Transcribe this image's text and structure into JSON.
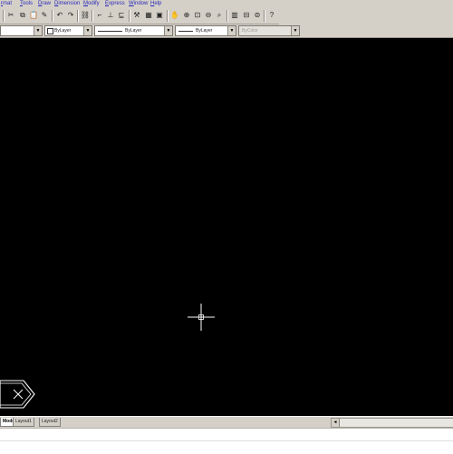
{
  "menubar": {
    "items": [
      "Format",
      "Tools",
      "Draw",
      "Dimension",
      "Modify",
      "Express",
      "Window",
      "Help"
    ],
    "visible_labels": [
      "rmat",
      "Tools",
      "Draw",
      "Dimension",
      "Modify",
      "Express",
      "Window",
      "Help"
    ]
  },
  "toolbar": {
    "buttons": [
      {
        "name": "cut-icon",
        "glyph": "✂"
      },
      {
        "name": "copy-icon",
        "glyph": "⧉"
      },
      {
        "name": "paste-icon",
        "glyph": "📋"
      },
      {
        "name": "match-properties-icon",
        "glyph": "✎"
      },
      {
        "name": "undo-icon",
        "glyph": "↶"
      },
      {
        "name": "redo-icon",
        "glyph": "↷"
      },
      {
        "name": "hyperlink-icon",
        "glyph": "⛓"
      },
      {
        "name": "osnap-icon",
        "glyph": "⌐"
      },
      {
        "name": "ucs-icon",
        "glyph": "⊥"
      },
      {
        "name": "redraw-icon",
        "glyph": "⊑"
      },
      {
        "name": "properties-icon",
        "glyph": "⚒"
      },
      {
        "name": "design-center-icon",
        "glyph": "▦"
      },
      {
        "name": "tool-palettes-icon",
        "glyph": "▣"
      },
      {
        "name": "pan-icon",
        "glyph": "✋"
      },
      {
        "name": "zoom-realtime-icon",
        "glyph": "⊕"
      },
      {
        "name": "zoom-window-icon",
        "glyph": "⊡"
      },
      {
        "name": "zoom-previous-icon",
        "glyph": "⊖"
      },
      {
        "name": "zoom-extents-icon",
        "glyph": "⌕"
      },
      {
        "name": "named-views-icon",
        "glyph": "▥"
      },
      {
        "name": "aerial-view-icon",
        "glyph": "⊟"
      },
      {
        "name": "distance-icon",
        "glyph": "⊜"
      },
      {
        "name": "help-icon",
        "glyph": "?"
      }
    ]
  },
  "properties": {
    "layer_value": "",
    "color_value": "ByLayer",
    "linetype_value": "ByLayer",
    "lineweight_value": "ByLayer",
    "plotstyle_value": "ByColor"
  },
  "layout_tabs": [
    "Model",
    "Layout1",
    "Layout2"
  ],
  "scroll": {
    "left_arrow": "◄"
  },
  "colors": {
    "canvas": "#000000",
    "chrome": "#d4d0c8",
    "menu_text": "#2a2ab8",
    "crosshair": "#ffffff"
  }
}
